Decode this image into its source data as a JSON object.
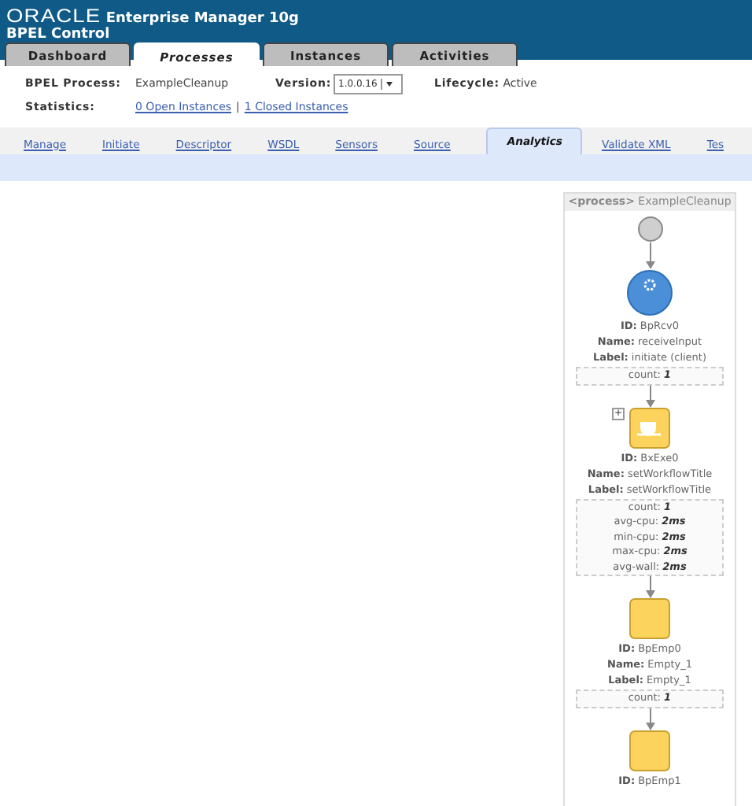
{
  "header": {
    "logo": "ORACLE",
    "product": "Enterprise Manager 10g",
    "subtitle": "BPEL Control"
  },
  "tabs": [
    {
      "label": "Dashboard",
      "selected": false
    },
    {
      "label": "Processes",
      "selected": true
    },
    {
      "label": "Instances",
      "selected": false
    },
    {
      "label": "Activities",
      "selected": false
    }
  ],
  "process_info": {
    "process_label": "BPEL Process:",
    "process_name": "ExampleCleanup",
    "version_label": "Version:",
    "version_value": "1.0.0.16",
    "lifecycle_label": "Lifecycle:",
    "lifecycle_value": "Active",
    "statistics_label": "Statistics:",
    "open_instances": "0 Open Instances",
    "separator": "|",
    "closed_instances": "1 Closed Instances"
  },
  "sub_tabs": [
    {
      "label": "Manage",
      "selected": false
    },
    {
      "label": "Initiate",
      "selected": false
    },
    {
      "label": "Descriptor",
      "selected": false
    },
    {
      "label": "WSDL",
      "selected": false
    },
    {
      "label": "Sensors",
      "selected": false
    },
    {
      "label": "Source",
      "selected": false
    },
    {
      "label": "Analytics",
      "selected": true
    },
    {
      "label": "Validate XML",
      "selected": false
    },
    {
      "label": "Tes",
      "selected": false
    }
  ],
  "diagram": {
    "tag": "<process>",
    "title": "ExampleCleanup",
    "nodes": [
      {
        "kind": "start"
      },
      {
        "kind": "receive",
        "fields": [
          {
            "label": "ID:",
            "value": "BpRcv0"
          },
          {
            "label": "Name:",
            "value": "receiveInput"
          },
          {
            "label": "Label:",
            "value": "initiate (client)"
          }
        ],
        "stats": [
          {
            "label": "count:",
            "value": "1"
          }
        ]
      },
      {
        "kind": "exec",
        "expander": "+",
        "fields": [
          {
            "label": "ID:",
            "value": "BxExe0"
          },
          {
            "label": "Name:",
            "value": "setWorkflowTitle"
          },
          {
            "label": "Label:",
            "value": "setWorkflowTitle"
          }
        ],
        "stats": [
          {
            "label": "count:",
            "value": "1"
          },
          {
            "label": "avg-cpu:",
            "value": "2ms"
          },
          {
            "label": "min-cpu:",
            "value": "2ms"
          },
          {
            "label": "max-cpu:",
            "value": "2ms"
          },
          {
            "label": "avg-wall:",
            "value": "2ms"
          }
        ]
      },
      {
        "kind": "empty",
        "fields": [
          {
            "label": "ID:",
            "value": "BpEmp0"
          },
          {
            "label": "Name:",
            "value": "Empty_1"
          },
          {
            "label": "Label:",
            "value": "Empty_1"
          }
        ],
        "stats": [
          {
            "label": "count:",
            "value": "1"
          }
        ]
      },
      {
        "kind": "empty",
        "fields": [
          {
            "label": "ID:",
            "value": "BpEmp1"
          }
        ]
      }
    ]
  }
}
